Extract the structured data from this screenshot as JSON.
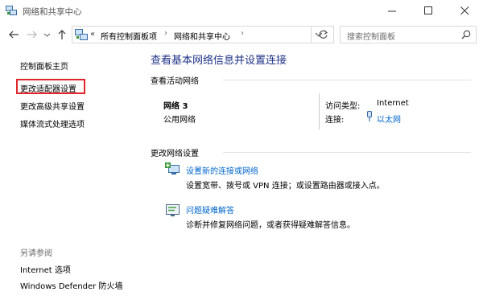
{
  "window": {
    "title": "网络和共享中心"
  },
  "address_bar": {
    "overflow": "«",
    "crumbs": [
      "所有控制面板项",
      "网络和共享中心"
    ],
    "separator": "›"
  },
  "search": {
    "placeholder": "搜索控制面板"
  },
  "left_pane": {
    "home": "控制面板主页",
    "links": [
      "更改适配器设置",
      "更改高级共享设置",
      "媒体流式处理选项"
    ],
    "see_also_label": "另请参阅",
    "see_also": [
      "Internet 选项",
      "Windows Defender 防火墙"
    ]
  },
  "main": {
    "title": "查看基本网络信息并设置连接",
    "active_section": "查看活动网络",
    "network": {
      "name": "网络 3",
      "type": "公用网络",
      "access_type_label": "访问类型:",
      "access_type_value": "Internet",
      "connections_label": "连接:",
      "connections_value": "以太网"
    },
    "change_section": "更改网络设置",
    "tasks": [
      {
        "link": "设置新的连接或网络",
        "desc": "设置宽带、拨号或 VPN 连接；或设置路由器或接入点。"
      },
      {
        "link": "问题疑难解答",
        "desc": "诊断并修复网络问题，或者获得疑难解答信息。"
      }
    ]
  },
  "colors": {
    "title_blue": "#1e3287",
    "link_blue": "#0066cc",
    "highlight_red": "#e0262a"
  }
}
